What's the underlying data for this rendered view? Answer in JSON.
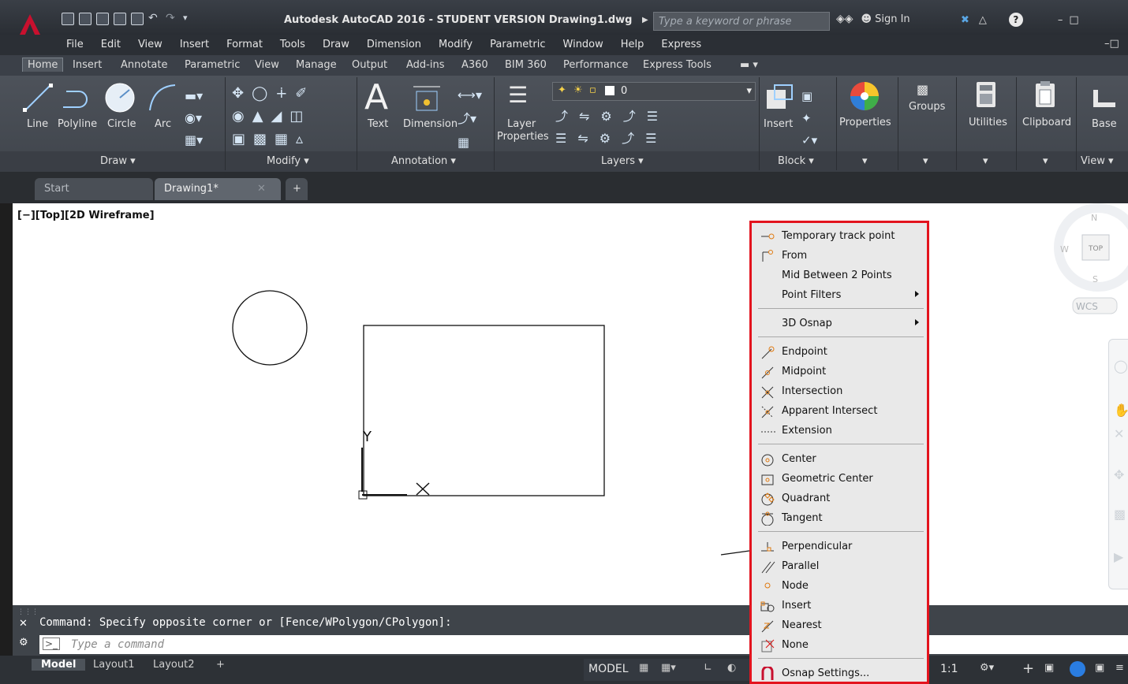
{
  "window": {
    "title": "Autodesk AutoCAD 2016 - STUDENT VERSION    Drawing1.dwg",
    "search_placeholder": "Type a keyword or phrase",
    "sign_in": "Sign In"
  },
  "menu": [
    "File",
    "Edit",
    "View",
    "Insert",
    "Format",
    "Tools",
    "Draw",
    "Dimension",
    "Modify",
    "Parametric",
    "Window",
    "Help",
    "Express"
  ],
  "ribbon_tabs": [
    "Home",
    "Insert",
    "Annotate",
    "Parametric",
    "View",
    "Manage",
    "Output",
    "Add-ins",
    "A360",
    "BIM 360",
    "Performance",
    "Express Tools"
  ],
  "ribbon_tools": {
    "line": "Line",
    "polyline": "Polyline",
    "circle": "Circle",
    "arc": "Arc",
    "text": "Text",
    "dimension": "Dimension",
    "layer_properties_1": "Layer",
    "layer_properties_2": "Properties",
    "layer_current": "0",
    "insert": "Insert",
    "properties": "Properties",
    "groups": "Groups",
    "utilities": "Utilities",
    "clipboard": "Clipboard",
    "base": "Base"
  },
  "ribbon_panels": {
    "draw": "Draw",
    "modify": "Modify",
    "annotation": "Annotation",
    "layers": "Layers",
    "block": "Block",
    "view": "View"
  },
  "doc_tabs": {
    "start": "Start",
    "drawing": "Drawing1*"
  },
  "viewport": {
    "label": "[−][Top][2D Wireframe]",
    "ucs_y": "Y",
    "viewcube_top": "TOP",
    "viewcube_n": "N",
    "viewcube_w": "W",
    "viewcube_s": "S",
    "wcs": "WCS"
  },
  "command": {
    "history": "Command: Specify opposite corner or [Fence/WPolygon/CPolygon]:",
    "placeholder": "Type a command"
  },
  "layout_tabs": [
    "Model",
    "Layout1",
    "Layout2"
  ],
  "status": {
    "model": "MODEL",
    "scale": "1:1"
  },
  "snap_menu": {
    "g1": [
      "Temporary track point",
      "From",
      "Mid Between 2 Points",
      "Point Filters"
    ],
    "g2": [
      "3D Osnap"
    ],
    "g3": [
      "Endpoint",
      "Midpoint",
      "Intersection",
      "Apparent Intersect",
      "Extension"
    ],
    "g4": [
      "Center",
      "Geometric Center",
      "Quadrant",
      "Tangent"
    ],
    "g5": [
      "Perpendicular",
      "Parallel",
      "Node",
      "Insert",
      "Nearest",
      "None"
    ],
    "g6": [
      "Osnap Settings..."
    ]
  },
  "colors": {
    "highlight_border": "#e3141e",
    "logo_red": "#c8102e"
  }
}
